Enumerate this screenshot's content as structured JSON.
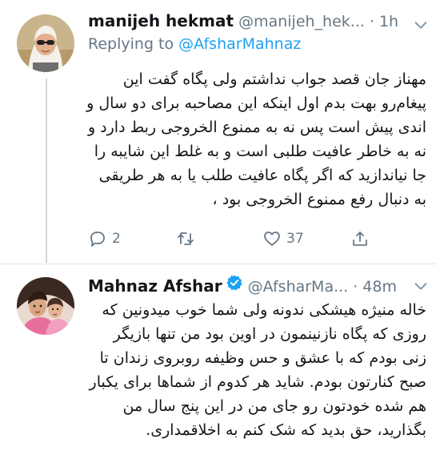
{
  "tweets": [
    {
      "name": "manijeh hekmat",
      "handle": "@manijeh_hek...",
      "separator": "·",
      "time": "1h",
      "replying_label": "Replying to",
      "replying_to": "@AfsharMahnaz",
      "text": "مهناز جان قصد جواب نداشتم ولی پگاه گفت این پیغام‌رو بهت بدم اول اینکه این مصاحبه برای دو سال و اندی پیش است پس نه به ممنوع الخروجی ربط دارد و نه به خاطر عافیت طلبی است و به غلط این شایبه را جا نیاندازید که اگر پگاه عافیت طلب یا به هر طریقی به دنبال رفع ممنوع الخروجی بود ،",
      "reply_count": "2",
      "retweet_count": "",
      "like_count": "37",
      "avatar_icon": "woman-sunglasses-avatar",
      "colors": {
        "scarf": "#f4f0ea",
        "background": "#c9b48c"
      }
    },
    {
      "name": "Mahnaz Afshar",
      "verified": true,
      "handle": "@AfsharMa...",
      "separator": "·",
      "time": "48m",
      "text": "خاله منیژه هیشکی ندونه ولی شما خوب میدونین که روزی که پگاه نازنینمون در اوین بود من تنها بازیگر زنی بودم که با عشق و حس وظیفه روبروی زندان تا صبح کنارتون بودم. شاید هر کدوم از شماها برای یکبار هم شده خودتون رو جای من در  این پنج سال من بگذارید، حق بدید که شک کنم به اخلاقمداری.",
      "avatar_icon": "woman-with-child-avatar"
    }
  ],
  "colors": {
    "link": "#1da1f2",
    "secondary_text": "#657786",
    "divider": "#e1e8ed",
    "thread_line": "#ccd6dd"
  },
  "icons": [
    "chevron-down-icon",
    "reply-icon",
    "retweet-icon",
    "like-icon",
    "share-icon",
    "verified-badge-icon"
  ]
}
